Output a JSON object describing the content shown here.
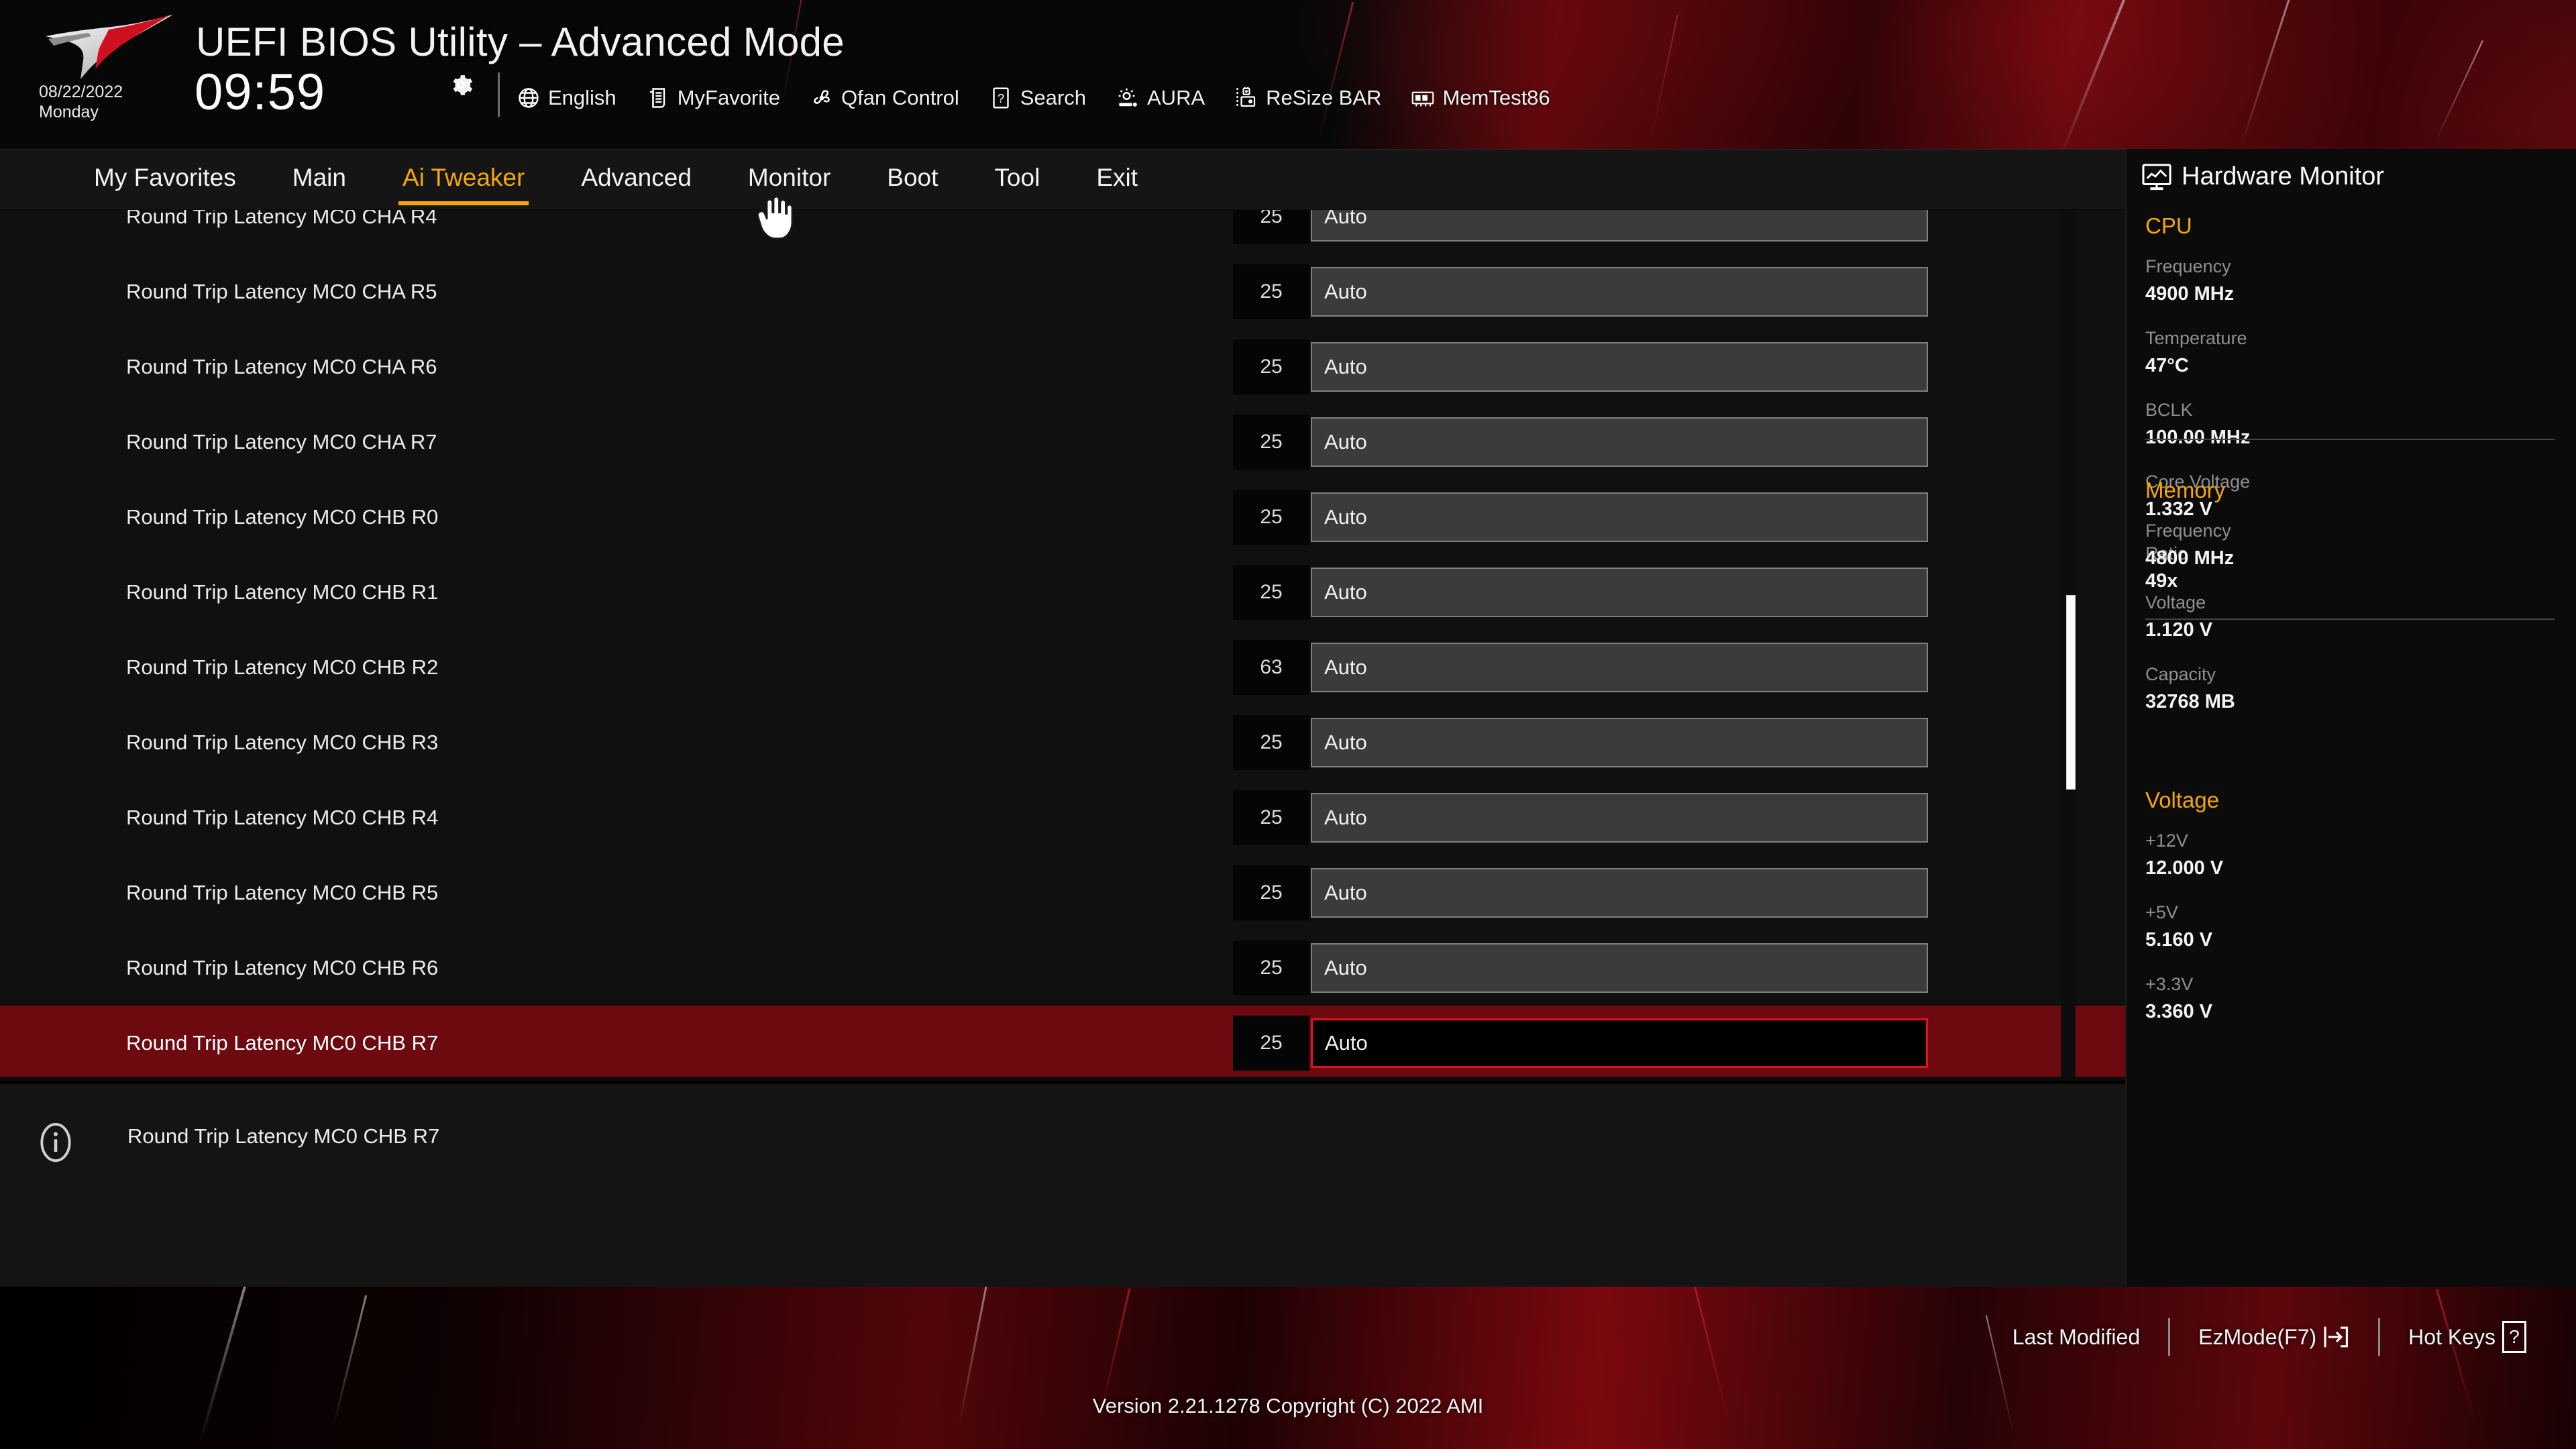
{
  "header": {
    "title": "UEFI BIOS Utility – Advanced Mode",
    "date": "08/22/2022",
    "weekday": "Monday",
    "time": "09:59",
    "gear_icon": "gear-icon",
    "toolbar": [
      {
        "label": "English",
        "icon": "globe-icon"
      },
      {
        "label": "MyFavorite",
        "icon": "favorite-list-icon"
      },
      {
        "label": "Qfan Control",
        "icon": "fan-icon"
      },
      {
        "label": "Search",
        "icon": "question-box-icon"
      },
      {
        "label": "AURA",
        "icon": "aura-light-icon"
      },
      {
        "label": "ReSize BAR",
        "icon": "resize-bar-icon"
      },
      {
        "label": "MemTest86",
        "icon": "memory-module-icon"
      }
    ]
  },
  "nav": {
    "tabs": [
      {
        "label": "My Favorites",
        "active": false
      },
      {
        "label": "Main",
        "active": false
      },
      {
        "label": "Ai Tweaker",
        "active": true
      },
      {
        "label": "Advanced",
        "active": false
      },
      {
        "label": "Monitor",
        "active": false
      },
      {
        "label": "Boot",
        "active": false
      },
      {
        "label": "Tool",
        "active": false
      },
      {
        "label": "Exit",
        "active": false
      }
    ],
    "active_color": "#f5a60a"
  },
  "main": {
    "rows": [
      {
        "label": "Round Trip Latency MC0 CHA R4",
        "num": "25",
        "value": "Auto",
        "selected": false
      },
      {
        "label": "Round Trip Latency MC0 CHA R5",
        "num": "25",
        "value": "Auto",
        "selected": false
      },
      {
        "label": "Round Trip Latency MC0 CHA R6",
        "num": "25",
        "value": "Auto",
        "selected": false
      },
      {
        "label": "Round Trip Latency MC0 CHA R7",
        "num": "25",
        "value": "Auto",
        "selected": false
      },
      {
        "label": "Round Trip Latency MC0 CHB R0",
        "num": "25",
        "value": "Auto",
        "selected": false
      },
      {
        "label": "Round Trip Latency MC0 CHB R1",
        "num": "25",
        "value": "Auto",
        "selected": false
      },
      {
        "label": "Round Trip Latency MC0 CHB R2",
        "num": "63",
        "value": "Auto",
        "selected": false
      },
      {
        "label": "Round Trip Latency MC0 CHB R3",
        "num": "25",
        "value": "Auto",
        "selected": false
      },
      {
        "label": "Round Trip Latency MC0 CHB R4",
        "num": "25",
        "value": "Auto",
        "selected": false
      },
      {
        "label": "Round Trip Latency MC0 CHB R5",
        "num": "25",
        "value": "Auto",
        "selected": false
      },
      {
        "label": "Round Trip Latency MC0 CHB R6",
        "num": "25",
        "value": "Auto",
        "selected": false
      },
      {
        "label": "Round Trip Latency MC0 CHB R7",
        "num": "25",
        "value": "Auto",
        "selected": true
      }
    ]
  },
  "info": {
    "icon": "info-icon",
    "text": "Round Trip Latency MC0 CHB R7"
  },
  "sidebar": {
    "title": "Hardware Monitor",
    "title_icon": "monitor-graph-icon",
    "sections": [
      {
        "name": "CPU",
        "cells": [
          {
            "key": "Frequency",
            "value": "4900 MHz"
          },
          {
            "key": "Temperature",
            "value": "47°C"
          },
          {
            "key": "BCLK",
            "value": "100.00 MHz"
          },
          {
            "key": "Core Voltage",
            "value": "1.332 V"
          },
          {
            "key": "Ratio",
            "value": "49x"
          }
        ]
      },
      {
        "name": "Memory",
        "cells": [
          {
            "key": "Frequency",
            "value": "4800 MHz"
          },
          {
            "key": "Voltage",
            "value": "1.120 V"
          },
          {
            "key": "Capacity",
            "value": "32768 MB"
          }
        ]
      },
      {
        "name": "Voltage",
        "cells": [
          {
            "key": "+12V",
            "value": "12.000 V"
          },
          {
            "key": "+5V",
            "value": "5.160 V"
          },
          {
            "key": "+3.3V",
            "value": "3.360 V"
          }
        ]
      }
    ],
    "accent_color": "#f5a60a"
  },
  "footer": {
    "version": "Version 2.21.1278 Copyright (C) 2022 AMI",
    "last_modified": "Last Modified",
    "ezmode": "EzMode(F7)",
    "hotkeys": "Hot Keys",
    "hotkeys_glyph": "?"
  }
}
